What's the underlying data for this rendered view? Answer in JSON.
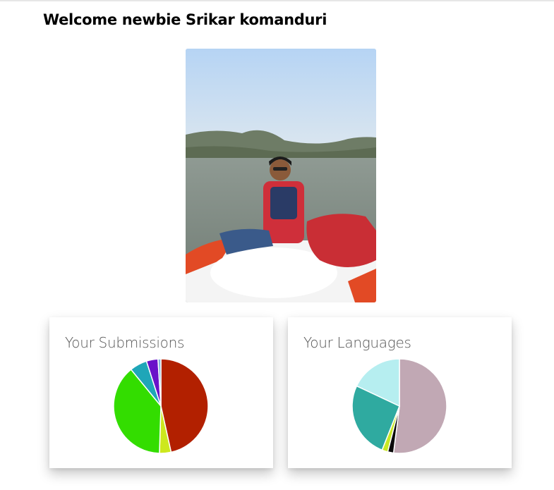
{
  "header": {
    "welcome": "Welcome newbie Srikar komanduri"
  },
  "profile_photo": {
    "description": "Profile photo: person in red life jacket on a paddle boat on a lake"
  },
  "submissions_card": {
    "title": "Your Submissions",
    "chart_data": {
      "type": "pie",
      "values": [
        47,
        4,
        39,
        6,
        4,
        1
      ],
      "colors": [
        "#b22000",
        "#cde81e",
        "#33dd00",
        "#1fa6b8",
        "#6a11c9",
        "#7fb5d8"
      ]
    }
  },
  "languages_card": {
    "title": "Your Languages",
    "chart_data": {
      "type": "pie",
      "values": [
        52,
        2,
        2,
        26,
        18
      ],
      "colors": [
        "#c1a8b4",
        "#0a0a0a",
        "#c8e825",
        "#2faaa0",
        "#b6eef0"
      ]
    }
  }
}
